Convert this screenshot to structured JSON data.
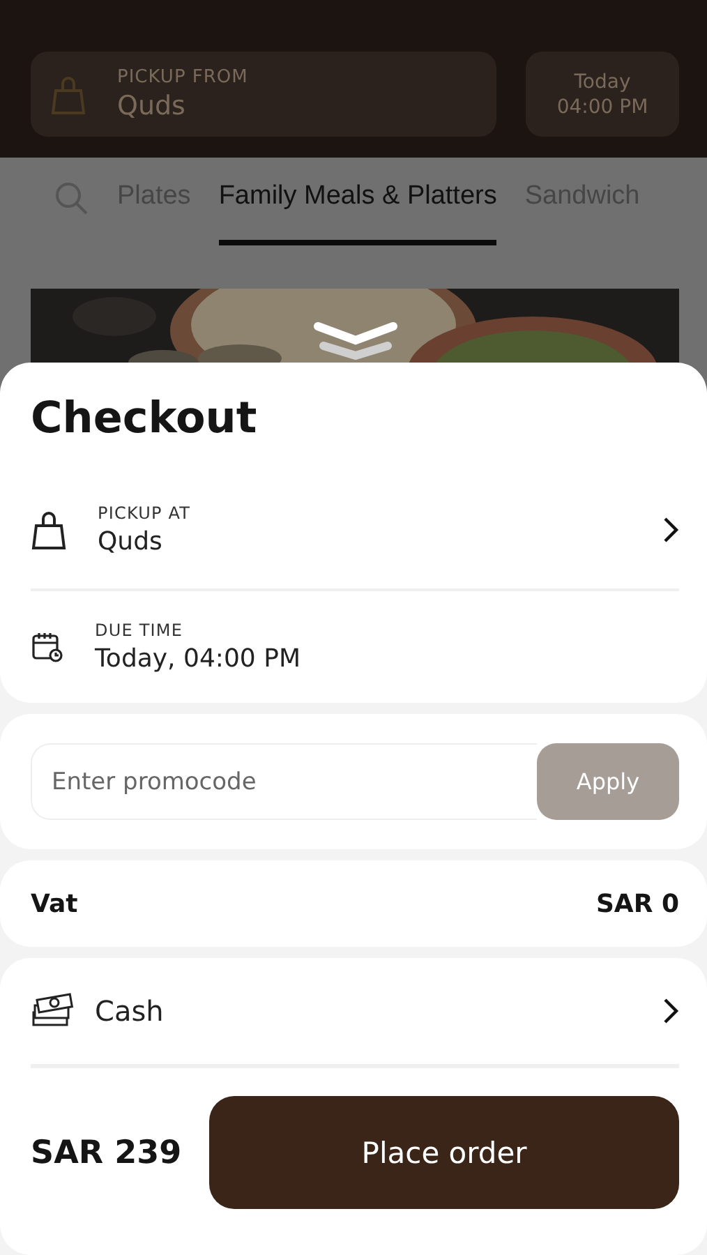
{
  "header": {
    "pickup_label": "PICKUP FROM",
    "pickup_value": "Quds",
    "time_day": "Today",
    "time_clock": "04:00 PM"
  },
  "tabs": [
    {
      "label": "Plates",
      "selected": false
    },
    {
      "label": "Family Meals & Platters",
      "selected": true
    },
    {
      "label": "Sandwich",
      "selected": false
    }
  ],
  "checkout": {
    "title": "Checkout",
    "rows": [
      {
        "kind": "pickup",
        "label": "PICKUP AT",
        "value": "Quds"
      },
      {
        "kind": "time",
        "label": "DUE TIME",
        "value": "Today, 04:00 PM"
      }
    ]
  },
  "promo": {
    "placeholder": "Enter promocode",
    "button": "Apply"
  },
  "vat": {
    "label": "Vat",
    "value": "SAR 0"
  },
  "payment": {
    "kind": "cash",
    "method": "Cash"
  },
  "total": {
    "amount": "SAR 239",
    "button": "Place order"
  }
}
